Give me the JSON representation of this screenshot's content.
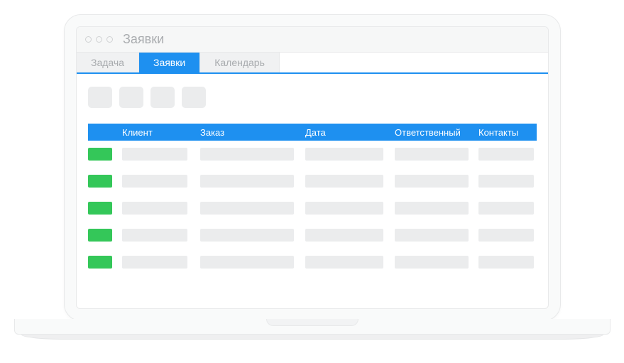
{
  "window": {
    "title": "Заявки"
  },
  "tabs": [
    {
      "label": "Задача",
      "active": false
    },
    {
      "label": "Заявки",
      "active": true
    },
    {
      "label": "Календарь",
      "active": false
    }
  ],
  "table": {
    "columns": {
      "client": "Клиент",
      "order": "Заказ",
      "date": "Дата",
      "responsible": "Ответственный",
      "contacts": "Контакты"
    },
    "rows": [
      {
        "status": "green"
      },
      {
        "status": "green"
      },
      {
        "status": "green"
      },
      {
        "status": "green"
      },
      {
        "status": "green"
      }
    ]
  },
  "colors": {
    "accent": "#1e90f0",
    "status_green": "#34c759",
    "placeholder": "#ebeced"
  }
}
